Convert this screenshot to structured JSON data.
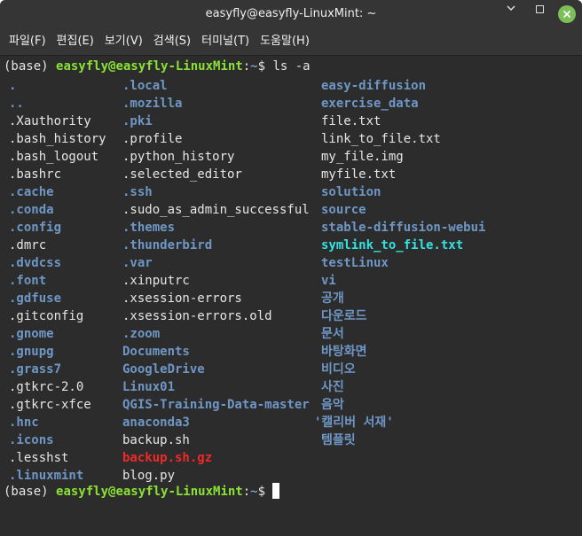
{
  "window": {
    "title": "easyfly@easyfly-LinuxMint: ~",
    "minimize_glyph": "⌄",
    "maximize_glyph": "□",
    "close_glyph": "✕"
  },
  "menu": [
    {
      "label": "파일(F)"
    },
    {
      "label": "편집(E)"
    },
    {
      "label": "보기(V)"
    },
    {
      "label": "검색(S)"
    },
    {
      "label": "터미널(T)"
    },
    {
      "label": "도움말(H)"
    }
  ],
  "terminal": {
    "prompt1": {
      "env": "(base) ",
      "user_host": "easyfly@easyfly-LinuxMint",
      "sep": ":",
      "path": "~",
      "dollar": "$ ",
      "command": "ls -a"
    },
    "prompt2": {
      "env": "(base) ",
      "user_host": "easyfly@easyfly-LinuxMint",
      "sep": ":",
      "path": "~",
      "dollar": "$ "
    },
    "columns": [
      [
        {
          "name": ".",
          "kind": "dir"
        },
        {
          "name": "..",
          "kind": "dir"
        },
        {
          "name": ".Xauthority",
          "kind": "file"
        },
        {
          "name": ".bash_history",
          "kind": "file"
        },
        {
          "name": ".bash_logout",
          "kind": "file"
        },
        {
          "name": ".bashrc",
          "kind": "file"
        },
        {
          "name": ".cache",
          "kind": "dir"
        },
        {
          "name": ".conda",
          "kind": "dir"
        },
        {
          "name": ".config",
          "kind": "dir"
        },
        {
          "name": ".dmrc",
          "kind": "file"
        },
        {
          "name": ".dvdcss",
          "kind": "dir"
        },
        {
          "name": ".font",
          "kind": "dir"
        },
        {
          "name": ".gdfuse",
          "kind": "dir"
        },
        {
          "name": ".gitconfig",
          "kind": "file"
        },
        {
          "name": ".gnome",
          "kind": "dir"
        },
        {
          "name": ".gnupg",
          "kind": "dir"
        },
        {
          "name": ".grass7",
          "kind": "dir"
        },
        {
          "name": ".gtkrc-2.0",
          "kind": "file"
        },
        {
          "name": ".gtkrc-xfce",
          "kind": "file"
        },
        {
          "name": ".hnc",
          "kind": "dir"
        },
        {
          "name": ".icons",
          "kind": "dir"
        },
        {
          "name": ".lesshst",
          "kind": "file"
        },
        {
          "name": ".linuxmint",
          "kind": "dir"
        }
      ],
      [
        {
          "name": ".local",
          "kind": "dir"
        },
        {
          "name": ".mozilla",
          "kind": "dir"
        },
        {
          "name": ".pki",
          "kind": "dir"
        },
        {
          "name": ".profile",
          "kind": "file"
        },
        {
          "name": ".python_history",
          "kind": "file"
        },
        {
          "name": ".selected_editor",
          "kind": "file"
        },
        {
          "name": ".ssh",
          "kind": "dir"
        },
        {
          "name": ".sudo_as_admin_successful",
          "kind": "file"
        },
        {
          "name": ".themes",
          "kind": "dir"
        },
        {
          "name": ".thunderbird",
          "kind": "dir"
        },
        {
          "name": ".var",
          "kind": "dir"
        },
        {
          "name": ".xinputrc",
          "kind": "file"
        },
        {
          "name": ".xsession-errors",
          "kind": "file"
        },
        {
          "name": ".xsession-errors.old",
          "kind": "file"
        },
        {
          "name": ".zoom",
          "kind": "dir"
        },
        {
          "name": "Documents",
          "kind": "dir"
        },
        {
          "name": "GoogleDrive",
          "kind": "dir"
        },
        {
          "name": "Linux01",
          "kind": "dir"
        },
        {
          "name": "QGIS-Training-Data-master",
          "kind": "dir"
        },
        {
          "name": "anaconda3",
          "kind": "dir"
        },
        {
          "name": "backup.sh",
          "kind": "file"
        },
        {
          "name": "backup.sh.gz",
          "kind": "archive"
        },
        {
          "name": "blog.py",
          "kind": "file"
        }
      ],
      [
        {
          "name": "easy-diffusion",
          "kind": "dir"
        },
        {
          "name": "exercise_data",
          "kind": "dir"
        },
        {
          "name": "file.txt",
          "kind": "file"
        },
        {
          "name": "link_to_file.txt",
          "kind": "file"
        },
        {
          "name": "my_file.img",
          "kind": "file"
        },
        {
          "name": "myfile.txt",
          "kind": "file"
        },
        {
          "name": "solution",
          "kind": "dir"
        },
        {
          "name": "source",
          "kind": "dir"
        },
        {
          "name": "stable-diffusion-webui",
          "kind": "dir"
        },
        {
          "name": "symlink_to_file.txt",
          "kind": "link"
        },
        {
          "name": "testLinux",
          "kind": "dir"
        },
        {
          "name": "vi",
          "kind": "dir"
        },
        {
          "name": "공개",
          "kind": "dir"
        },
        {
          "name": "다운로드",
          "kind": "dir"
        },
        {
          "name": "문서",
          "kind": "dir"
        },
        {
          "name": "바탕화면",
          "kind": "dir"
        },
        {
          "name": "비디오",
          "kind": "dir"
        },
        {
          "name": "사진",
          "kind": "dir"
        },
        {
          "name": "음악",
          "kind": "dir"
        },
        {
          "name": "'캘리버 서재'",
          "kind": "dir"
        },
        {
          "name": "템플릿",
          "kind": "dir"
        }
      ]
    ]
  },
  "colors": {
    "directory": "#6f97c6",
    "file": "#e6e6e6",
    "symlink": "#34e2e2",
    "archive": "#ef2929",
    "user_host": "#8ae234",
    "path": "#729fcf",
    "terminal_bg": "#2c2c2c",
    "titlebar_bg": "#353535",
    "close_button": "#7cbf58"
  }
}
